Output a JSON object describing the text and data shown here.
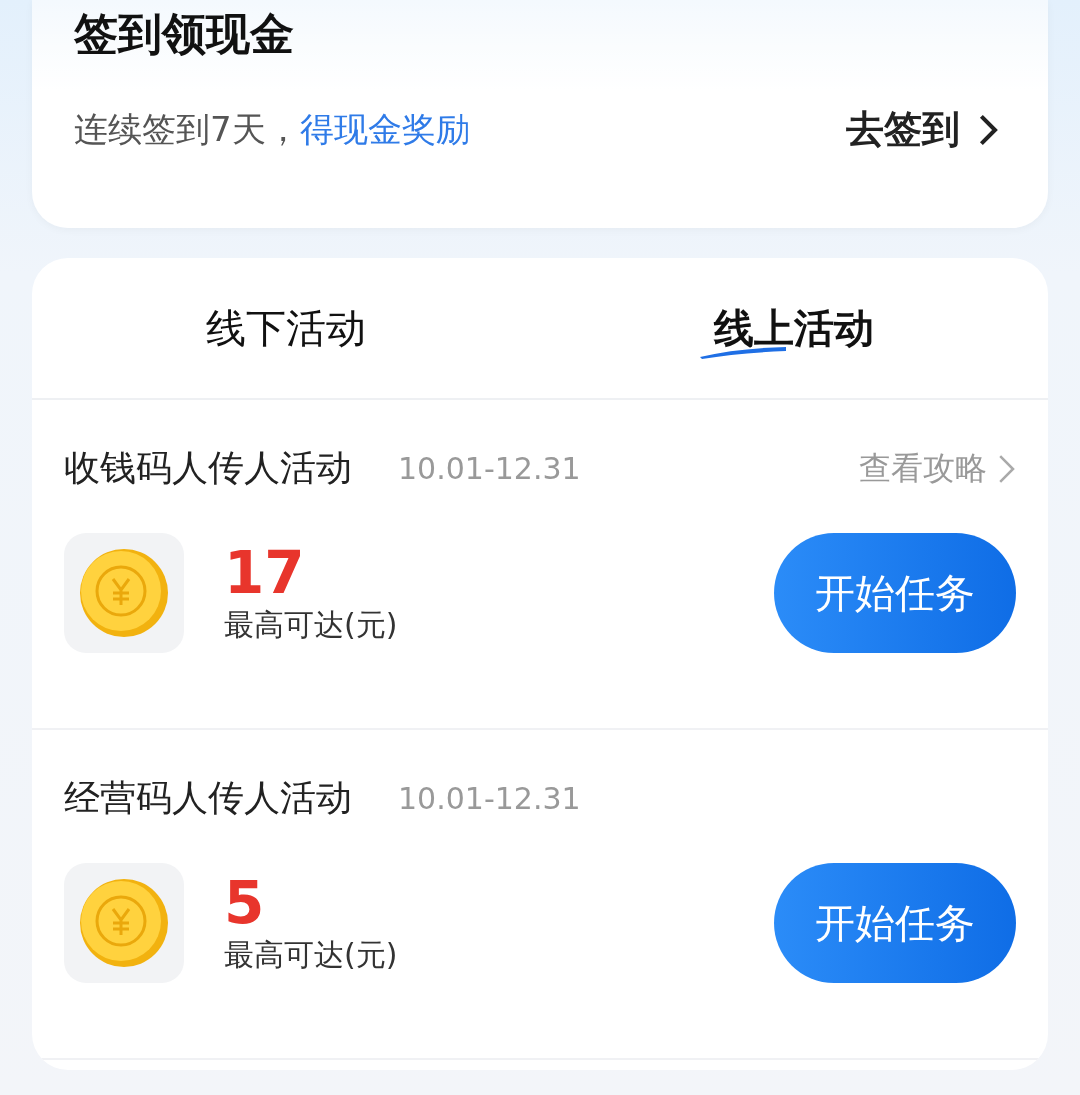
{
  "checkin_card": {
    "title": "签到领现金",
    "subtitle": "连续签到7天，",
    "subtitle_link": "得现金奖励",
    "action": "去签到"
  },
  "tabs": [
    {
      "label": "线下活动",
      "selected": false
    },
    {
      "label": "线上活动",
      "selected": true
    }
  ],
  "activities": [
    {
      "name": "收钱码人传人活动",
      "dates": "10.01-12.31",
      "guide": "查看攻略",
      "amount": "17",
      "amount_label": "最高可达(元)",
      "button": "开始任务"
    },
    {
      "name": "经营码人传人活动",
      "dates": "10.01-12.31",
      "amount": "5",
      "amount_label": "最高可达(元)",
      "button": "开始任务"
    }
  ]
}
